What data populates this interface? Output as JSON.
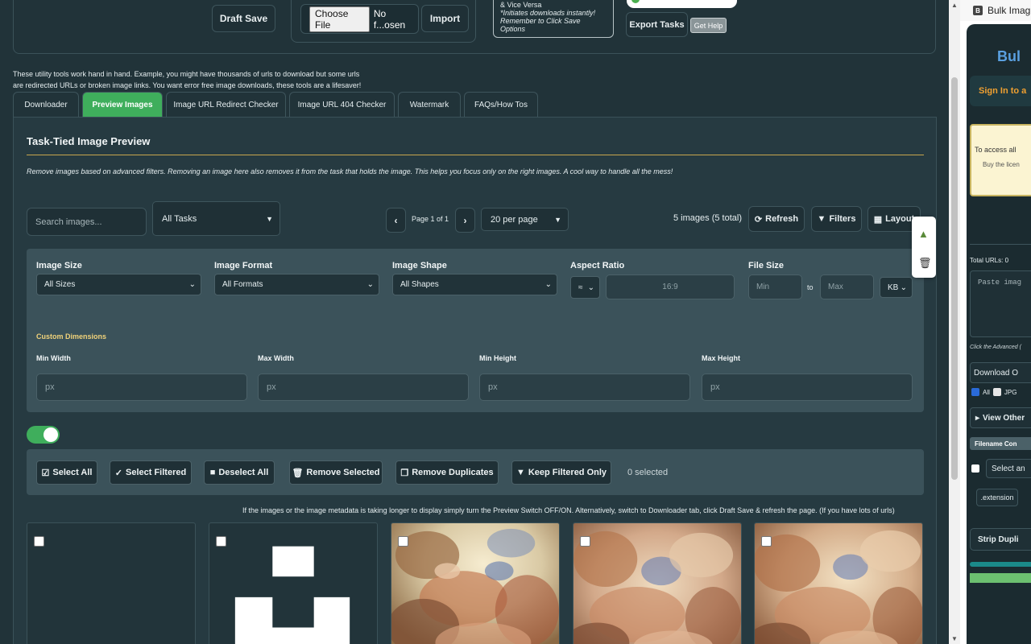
{
  "top": {
    "draft_save": "Draft Save",
    "choose_file": "Choose File",
    "file_status": "No f...osen",
    "import": "Import",
    "note_line1": "& Vice Versa",
    "note_line2": "*Initiates downloads instantly!",
    "note_line3": "Remember to Click Save Options",
    "export_tasks": "Export Tasks",
    "get_help": "Get Help"
  },
  "intro": {
    "line1": "These utility tools work hand in hand. Example, you might have thousands of urls to download but some urls",
    "line2": "are redirected URLs or broken image links. You want error free image downloads, these tools are a lifesaver!"
  },
  "tabs": [
    {
      "label": "Downloader",
      "active": false
    },
    {
      "label": "Preview Images",
      "active": true
    },
    {
      "label": "Image URL Redirect Checker",
      "active": false
    },
    {
      "label": "Image URL 404 Checker",
      "active": false
    },
    {
      "label": "Watermark",
      "active": false
    },
    {
      "label": "FAQs/How Tos",
      "active": false
    }
  ],
  "panel": {
    "title": "Task-Tied Image Preview",
    "description": "Remove images based on advanced filters. Removing an image here also removes it from the task that holds the image. This helps you focus only on the right images. A cool way to handle all the mess!"
  },
  "controls": {
    "search_placeholder": "Search images...",
    "task_select": "All Tasks",
    "page_label": "Page 1 of 1",
    "per_page": "20 per page",
    "count": "5 images (5 total)",
    "refresh": "Refresh",
    "filters": "Filters",
    "layout": "Layout"
  },
  "filters": {
    "image_size_label": "Image Size",
    "image_size_value": "All Sizes",
    "image_format_label": "Image Format",
    "image_format_value": "All Formats",
    "image_shape_label": "Image Shape",
    "image_shape_value": "All Shapes",
    "aspect_ratio_label": "Aspect Ratio",
    "aspect_op": "≈",
    "aspect_value": "16:9",
    "file_size_label": "File Size",
    "file_min": "Min",
    "file_to": "to",
    "file_max": "Max",
    "file_unit": "KB",
    "custom_dimensions": "Custom Dimensions",
    "min_width": "Min Width",
    "max_width": "Max Width",
    "min_height": "Min Height",
    "max_height": "Max Height",
    "px": "px"
  },
  "actions": {
    "select_all": "Select All",
    "select_filtered": "Select Filtered",
    "deselect_all": "Deselect All",
    "remove_selected": "Remove Selected",
    "remove_duplicates": "Remove Duplicates",
    "keep_filtered_only": "Keep Filtered Only",
    "selected_count": "0 selected"
  },
  "hint": "If the images or the image metadata is taking longer to display simply turn the Preview Switch OFF/ON. Alternatively, switch to Downloader tab, click Draft Save & refresh the page. (If you have lots of urls)",
  "sidepanel": {
    "badge": "B",
    "header": "Bulk Imag",
    "title": "Bul",
    "sign_in": "Sign In to a",
    "access_line1": "To access all",
    "access_line2": "Buy the licen",
    "total_urls": "Total URLs: 0",
    "paste_placeholder": "Paste imag",
    "click_hint": "Click the Advanced (",
    "download_options": "Download O",
    "check_all": "All",
    "check_jpg": "JPG",
    "view_other": "View Other",
    "filename_con": "Filename Con",
    "select_an": "Select an",
    "extension": ".extension",
    "strip_dupli": "Strip Dupli"
  },
  "colors": {
    "accent_green": "#3fae5c",
    "background": "#213339",
    "gold_rule": "#c7a64d"
  }
}
